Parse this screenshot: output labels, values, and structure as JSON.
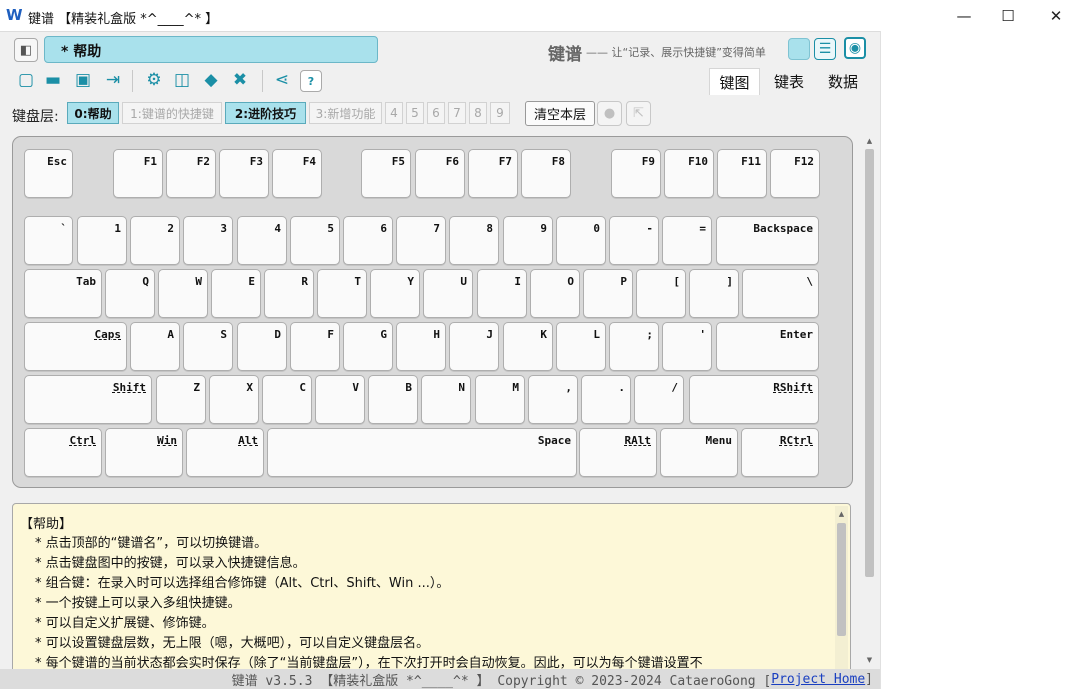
{
  "window": {
    "title": "键谱 【精装礼盒版 *^____^* 】",
    "minimize": "—",
    "maximize": "☐",
    "close": "✕"
  },
  "header": {
    "keyspec_name": "* 帮助",
    "brand": "键谱",
    "tagline": "—— 让“记录、展示快捷键”变得简单"
  },
  "view_tabs": [
    "键图",
    "键表",
    "数据"
  ],
  "layers": {
    "label": "键盘层:",
    "items": [
      "0:帮助",
      "1:键谱的快捷键",
      "2:进阶技巧",
      "3:新增功能",
      "4",
      "5",
      "6",
      "7",
      "8",
      "9"
    ],
    "clear_label": "清空本层"
  },
  "keyboard": {
    "rows": [
      [
        "Esc",
        "F1",
        "F2",
        "F3",
        "F4",
        "F5",
        "F6",
        "F7",
        "F8",
        "F9",
        "F10",
        "F11",
        "F12"
      ],
      [
        "`",
        "1",
        "2",
        "3",
        "4",
        "5",
        "6",
        "7",
        "8",
        "9",
        "0",
        "-",
        "=",
        "Backspace"
      ],
      [
        "Tab",
        "Q",
        "W",
        "E",
        "R",
        "T",
        "Y",
        "U",
        "I",
        "O",
        "P",
        "[",
        "]",
        "\\"
      ],
      [
        "Caps",
        "A",
        "S",
        "D",
        "F",
        "G",
        "H",
        "J",
        "K",
        "L",
        ";",
        "'",
        "Enter"
      ],
      [
        "Shift",
        "Z",
        "X",
        "C",
        "V",
        "B",
        "N",
        "M",
        ",",
        ".",
        "/",
        "RShift"
      ],
      [
        "Ctrl",
        "Win",
        "Alt",
        "Space",
        "RAlt",
        "Menu",
        "RCtrl"
      ]
    ]
  },
  "help": {
    "title": "【帮助】",
    "lines": [
      "* 点击顶部的“键谱名”，可以切换键谱。",
      "* 点击键盘图中的按键，可以录入快捷键信息。",
      "* 组合键：在录入时可以选择组合修饰键（Alt、Ctrl、Shift、Win ...）。",
      "* 一个按键上可以录入多组快捷键。",
      "* 可以自定义扩展键、修饰键。",
      "* 可以设置键盘层数，无上限（嗯，大概吧），可以自定义键盘层名。",
      "* 每个键谱的当前状态都会实时保存（除了“当前键盘层”），在下次打开时会自动恢复。因此，可以为每个键谱设置不"
    ]
  },
  "footer": {
    "text": "键谱 v3.5.3 【精装礼盒版 *^____^* 】 Copyright © 2023-2024 CataeroGong [",
    "link": "Project Home",
    "suffix": "]"
  },
  "colors": {
    "accent": "#a9e1ec",
    "icon": "#1b8fa6",
    "help_bg": "#fdf8d8"
  }
}
